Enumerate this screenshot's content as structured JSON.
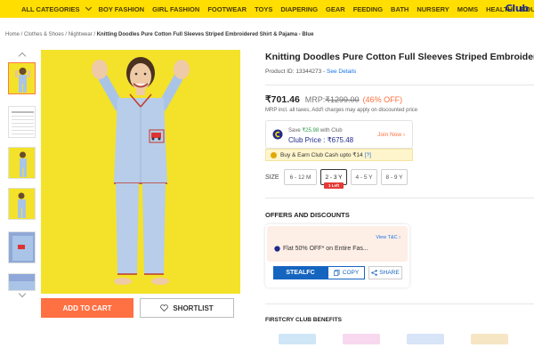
{
  "nav": {
    "items": [
      "ALL CATEGORIES",
      "BOY FASHION",
      "GIRL FASHION",
      "FOOTWEAR",
      "TOYS",
      "DIAPERING",
      "GEAR",
      "FEEDING",
      "BATH",
      "NURSERY",
      "MOMS",
      "HEALTH",
      "BOUTIQUES"
    ],
    "logo": "Club"
  },
  "breadcrumb": {
    "path": "Home / Clothes & Shoes / Nightwear / ",
    "current": "Knitting Doodles Pure Cotton Full Sleeves Striped Embroidered Shirt & Pajama - Blue"
  },
  "product": {
    "title": "Knitting Doodles Pure Cotton Full Sleeves Striped Embroidered Shirt",
    "id_label": "Product ID: 13344273 - ",
    "view_details": "See Details",
    "price": "₹701.46",
    "mrp_label": "MRP:",
    "mrp": "₹1299.00",
    "discount": "(46% OFF)",
    "tax_note": "MRP incl. all taxes, Add'l charges may apply on discounted price"
  },
  "club": {
    "save_prefix": "Save ",
    "save_amount": "₹25.98",
    "save_suffix": " with Club",
    "club_price": "Club Price : ₹675.48",
    "join_now": "Join Now ›",
    "cash_text": "Buy & Earn Club Cash upto ₹14",
    "cash_info": "[?]"
  },
  "size": {
    "label": "SIZE",
    "options": [
      "6 - 12 M",
      "2 - 3 Y",
      "4 - 5 Y",
      "8 - 9 Y"
    ],
    "selected_badge": "1 Left"
  },
  "offers": {
    "heading": "OFFERS AND DISCOUNTS",
    "view_tc": "View T&C ›",
    "text": "Flat 50% OFF* on Entire Fas...",
    "code": "STEALFC",
    "copy": "COPY",
    "share": "SHARE"
  },
  "benefits_heading": "FIRSTCRY CLUB BENEFITS",
  "actions": {
    "add_to_cart": "ADD TO CART",
    "shortlist": "SHORTLIST"
  },
  "colors": {
    "nav_bg": "#ffde00",
    "accent": "#ff7043",
    "club_blue": "#1f2a8a",
    "discount": "#ff6f3c",
    "image_bg": "#f3e229"
  }
}
